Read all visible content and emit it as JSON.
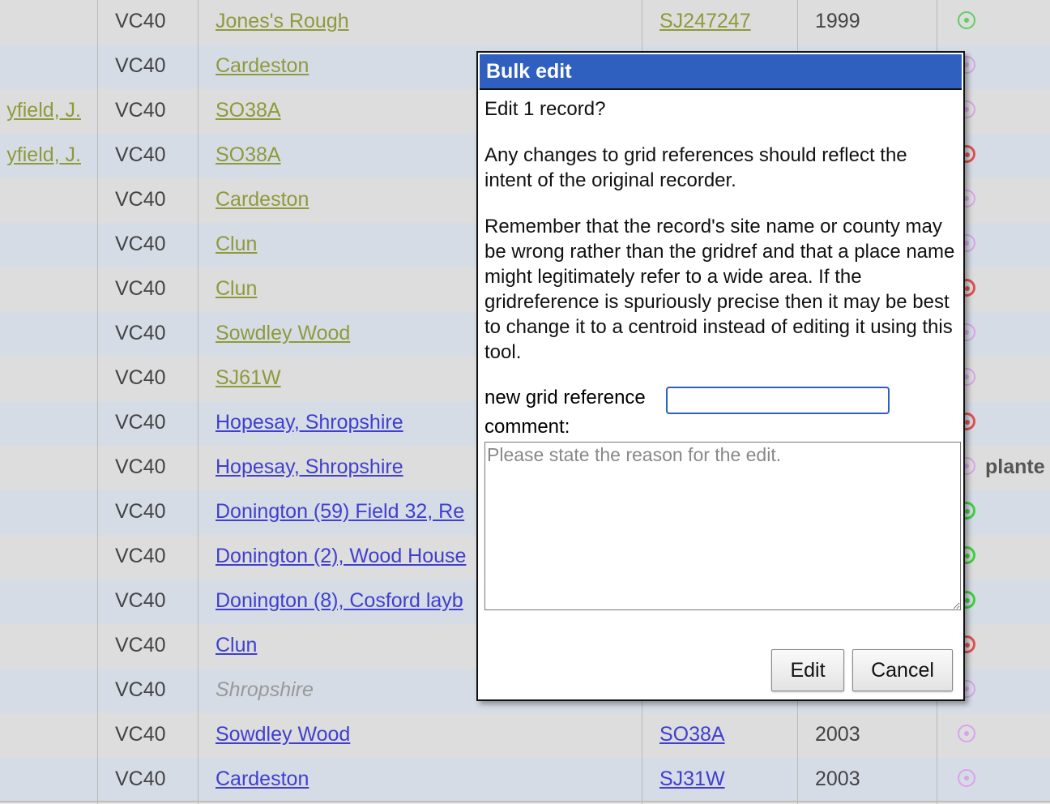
{
  "table": {
    "rows": [
      {
        "recorder": "",
        "vc": "VC40",
        "site": "Jones's Rough",
        "site_style": "olive",
        "grid": "SJ247247",
        "year": "1999",
        "status": "green",
        "note": ""
      },
      {
        "recorder": "",
        "vc": "VC40",
        "site": "Cardeston",
        "site_style": "olive",
        "grid": "",
        "year": "",
        "status": "pink",
        "note": ""
      },
      {
        "recorder": "yfield, J.",
        "vc": "VC40",
        "site": "SO38A",
        "site_style": "olive",
        "grid": "",
        "year": "",
        "status": "pink",
        "note": ""
      },
      {
        "recorder": "yfield, J.",
        "vc": "VC40",
        "site": "SO38A",
        "site_style": "olive",
        "grid": "",
        "year": "",
        "status": "red",
        "note": ""
      },
      {
        "recorder": "",
        "vc": "VC40",
        "site": "Cardeston",
        "site_style": "olive",
        "grid": "",
        "year": "",
        "status": "pink",
        "note": ""
      },
      {
        "recorder": "",
        "vc": "VC40",
        "site": "Clun",
        "site_style": "olive",
        "grid": "",
        "year": "",
        "status": "pink",
        "note": ""
      },
      {
        "recorder": "",
        "vc": "VC40",
        "site": "Clun",
        "site_style": "olive",
        "grid": "",
        "year": "",
        "status": "red",
        "note": ""
      },
      {
        "recorder": "",
        "vc": "VC40",
        "site": "Sowdley Wood",
        "site_style": "olive",
        "grid": "",
        "year": "",
        "status": "pink",
        "note": ""
      },
      {
        "recorder": "",
        "vc": "VC40",
        "site": "SJ61W",
        "site_style": "olive",
        "grid": "",
        "year": "",
        "status": "pink",
        "note": ""
      },
      {
        "recorder": "",
        "vc": "VC40",
        "site": "Hopesay, Shropshire",
        "site_style": "blue",
        "grid": "",
        "year": "",
        "status": "red",
        "note": ""
      },
      {
        "recorder": "",
        "vc": "VC40",
        "site": "Hopesay, Shropshire",
        "site_style": "blue",
        "grid": "",
        "year": "",
        "status": "pink",
        "note": "plante"
      },
      {
        "recorder": "",
        "vc": "VC40",
        "site": "Donington (59) Field 32, Re",
        "site_style": "blue",
        "grid": "",
        "year": "",
        "status": "green-solid",
        "note": ""
      },
      {
        "recorder": "",
        "vc": "VC40",
        "site": "Donington (2), Wood House",
        "site_style": "blue",
        "grid": "",
        "year": "",
        "status": "green-solid",
        "note": ""
      },
      {
        "recorder": "",
        "vc": "VC40",
        "site": "Donington (8), Cosford layb",
        "site_style": "blue",
        "grid": "",
        "year": "",
        "status": "green-solid",
        "note": ""
      },
      {
        "recorder": "",
        "vc": "VC40",
        "site": "Clun",
        "site_style": "blue",
        "grid": "",
        "year": "",
        "status": "red",
        "note": ""
      },
      {
        "recorder": "",
        "vc": "VC40",
        "site": "Shropshire",
        "site_style": "italic-grey",
        "grid": "",
        "year": "",
        "status": "pink",
        "note": ""
      },
      {
        "recorder": "",
        "vc": "VC40",
        "site": "Sowdley Wood",
        "site_style": "blue",
        "grid": "SO38A",
        "year": "2003",
        "status": "pink",
        "note": ""
      },
      {
        "recorder": "",
        "vc": "VC40",
        "site": "Cardeston",
        "site_style": "blue",
        "grid": "SJ31W",
        "year": "2003",
        "status": "pink",
        "note": ""
      }
    ]
  },
  "dialog": {
    "title": "Bulk edit",
    "line1": "Edit 1 record?",
    "para1": "Any changes to grid references should reflect the intent of the original recorder.",
    "para2": "Remember that the record's site name or county may be wrong rather than the gridref and that a place name might legitimately refer to a wide area. If the gridreference is spuriously precise then it may be best to change it to a centroid instead of editing it using this tool.",
    "grid_label": "new grid reference",
    "grid_value": "",
    "comment_label": "comment:",
    "comment_placeholder": "Please state the reason for the edit.",
    "edit_label": "Edit",
    "cancel_label": "Cancel"
  },
  "colors": {
    "dialog_title_bg": "#2f5fbf",
    "link_olive": "#8f9a3a",
    "link_blue": "#3f3fd0"
  }
}
